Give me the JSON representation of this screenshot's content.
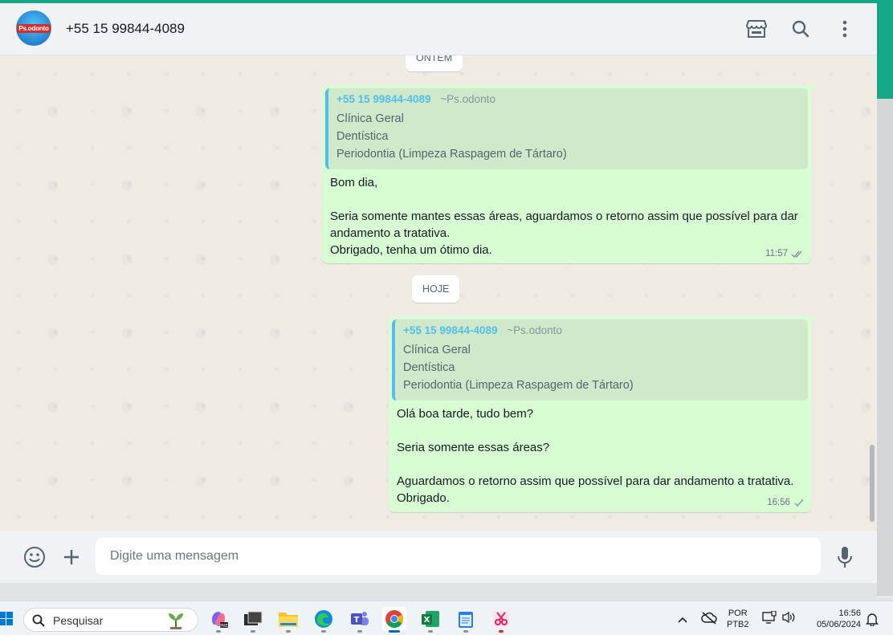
{
  "header": {
    "avatar_text": "Ps.odonto",
    "contact": "+55 15 99844-4089",
    "icons": [
      "catalog-icon",
      "search-icon",
      "kebab-menu-icon"
    ]
  },
  "chat": {
    "date_yesterday": "ONTEM",
    "date_today": "HOJE",
    "message1": {
      "quote_number": "+55 15 99844-4089",
      "quote_alias": "~Ps.odonto",
      "quote_lines": [
        "Clínica Geral",
        "Dentística",
        "Periodontia (Limpeza Raspagem de Tártaro)"
      ],
      "lines": [
        "Bom dia,",
        "",
        "Seria somente mantes essas áreas, aguardamos o retorno assim que possível para dar",
        "andamento a tratativa.",
        "Obrigado, tenha um ótimo dia."
      ],
      "time": "11:57",
      "status": "read"
    },
    "message2": {
      "quote_number": "+55 15 99844-4089",
      "quote_alias": "~Ps.odonto",
      "quote_lines": [
        "Clínica Geral",
        "Dentística",
        "Periodontia (Limpeza Raspagem de Tártaro)"
      ],
      "lines": [
        "Olá boa tarde, tudo bem?",
        "",
        "Seria somente essas áreas?",
        "",
        "Aguardamos o retorno assim que possível para dar andamento a tratativa.",
        "Obrigado."
      ],
      "time": "16:56",
      "status": "sent"
    }
  },
  "composer": {
    "placeholder": "Digite uma mensagem",
    "icons": [
      "emoji-icon",
      "attach-plus-icon",
      "microphone-icon"
    ]
  },
  "taskbar": {
    "search_placeholder": "Pesquisar",
    "pinned": [
      "copilot-icon",
      "terminal-icon",
      "file-explorer-icon",
      "edge-icon",
      "teams-icon",
      "chrome-icon",
      "excel-icon",
      "notepad-icon",
      "snipping-tool-icon"
    ],
    "active_app": "chrome-icon",
    "lang_top": "POR",
    "lang_bottom": "PTB2",
    "time": "16:56",
    "date": "05/06/2024"
  },
  "colors": {
    "accent": "#14a884",
    "bubble_out": "#d9fdd3",
    "quote_bar": "#53bdeb"
  }
}
